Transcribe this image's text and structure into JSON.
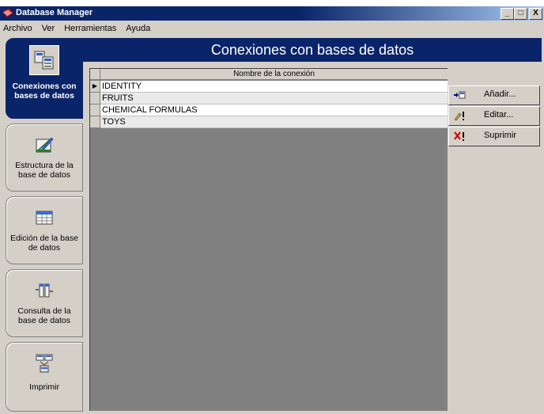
{
  "window": {
    "title": "Database Manager",
    "controls": [
      "_",
      "□",
      "X"
    ]
  },
  "menu": {
    "items": [
      {
        "label": "Archivo"
      },
      {
        "label": "Ver"
      },
      {
        "label": "Herramientas"
      },
      {
        "label": "Ayuda"
      }
    ]
  },
  "sidebar": {
    "items": [
      {
        "label": "Conexiones con bases de datos",
        "icon": "database-connections-icon",
        "active": true
      },
      {
        "label": "Estructura de la base de datos",
        "icon": "structure-icon",
        "active": false
      },
      {
        "label": "Edición de la base de datos",
        "icon": "table-edit-icon",
        "active": false
      },
      {
        "label": "Consulta de la base de datos",
        "icon": "query-icon",
        "active": false
      },
      {
        "label": "Imprimir",
        "icon": "print-icon",
        "active": false
      }
    ]
  },
  "main": {
    "header": "Conexiones con bases de datos",
    "grid": {
      "column_header": "Nombre de la conexión",
      "rows": [
        "IDENTITY",
        "FRUITS",
        "CHEMICAL FORMULAS",
        "TOYS"
      ],
      "current_row": 0
    },
    "buttons": [
      {
        "label": "Añadir...",
        "icon": "add-icon"
      },
      {
        "label": "Editar...",
        "icon": "edit-icon"
      },
      {
        "label": "Suprimir",
        "icon": "delete-icon"
      }
    ]
  },
  "colors": {
    "title_bar": "#0a246a",
    "header_bg": "#0a246a",
    "face": "#d4d0c8",
    "grid_bg": "#808080"
  }
}
